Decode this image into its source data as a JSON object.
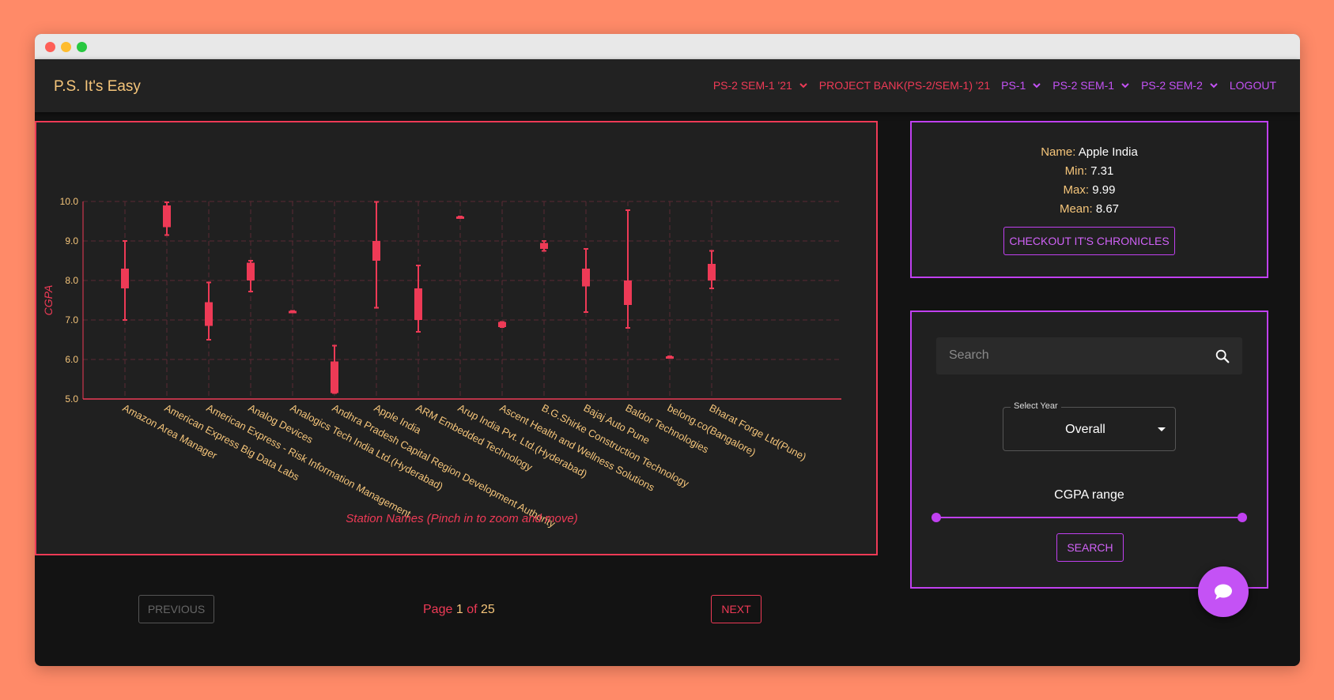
{
  "app": {
    "brand": "P.S. It's Easy"
  },
  "nav": [
    {
      "label": "PS-2 SEM-1 '21",
      "color": "#ee3a56",
      "dropdown": true
    },
    {
      "label": "PROJECT BANK(PS-2/SEM-1) '21",
      "color": "#ee3a56",
      "dropdown": false
    },
    {
      "label": "PS-1",
      "color": "#c452f5",
      "dropdown": true
    },
    {
      "label": "PS-2 SEM-1",
      "color": "#c452f5",
      "dropdown": true
    },
    {
      "label": "PS-2 SEM-2",
      "color": "#c452f5",
      "dropdown": true
    },
    {
      "label": "LOGOUT",
      "color": "#c452f5",
      "dropdown": false
    }
  ],
  "info": {
    "name_key": "Name:",
    "name": "Apple India",
    "min_key": "Min:",
    "min": "7.31",
    "max_key": "Max:",
    "max": "9.99",
    "mean_key": "Mean:",
    "mean": "8.67",
    "chronicles_button": "CHECKOUT IT'S CHRONICLES"
  },
  "filters": {
    "search_placeholder": "Search",
    "select_label": "Select Year",
    "select_value": "Overall",
    "range_label": "CGPA range",
    "range_value": [
      0,
      1
    ],
    "search_button": "SEARCH"
  },
  "pagination": {
    "previous": "PREVIOUS",
    "next": "NEXT",
    "page_word": "Page",
    "current": "1",
    "of_word": "of",
    "total": "25"
  },
  "colors": {
    "accent_red": "#ee3a56",
    "accent_purple": "#c452f5",
    "label_gold": "#f5c57a"
  },
  "chart_data": {
    "type": "box",
    "ylabel": "CGPA",
    "xlabel": "Station Names (Pinch in to zoom and move)",
    "ylim": [
      5.0,
      10.0
    ],
    "yticks": [
      "5.0",
      "6.0",
      "7.0",
      "8.0",
      "9.0",
      "10.0"
    ],
    "grid": true,
    "categories": [
      "Amazon Area Manager",
      "American Express Big Data Labs",
      "American Express - Risk Information Management",
      "Analog Devices",
      "Analogics Tech India Ltd.(Hyderabad)",
      "Andhra Pradesh Capital Region Development Authority",
      "Apple India",
      "ARM Embedded Technology",
      "Arup India Pvt. Ltd.(Hyderabad)",
      "Ascent Health and Wellness Solutions",
      "B.G.Shirke Construction Technology",
      "Bajaj Auto Pune",
      "Baldor Technologies",
      "belong.co(Bangalore)",
      "Bharat Forge Ltd(Pune)"
    ],
    "boxes": [
      {
        "min": 7.0,
        "q1": 7.8,
        "q3": 8.3,
        "max": 9.0
      },
      {
        "min": 9.15,
        "q1": 9.35,
        "q3": 9.9,
        "max": 9.98
      },
      {
        "min": 6.5,
        "q1": 6.85,
        "q3": 7.45,
        "max": 7.95
      },
      {
        "min": 7.72,
        "q1": 8.0,
        "q3": 8.45,
        "max": 8.5
      },
      {
        "min": 7.23,
        "q1": 7.23,
        "q3": 7.23,
        "max": 7.23
      },
      {
        "min": 5.15,
        "q1": 5.15,
        "q3": 5.95,
        "max": 6.35
      },
      {
        "min": 7.31,
        "q1": 8.5,
        "q3": 9.0,
        "max": 9.99
      },
      {
        "min": 6.7,
        "q1": 7.0,
        "q3": 7.8,
        "max": 8.38
      },
      {
        "min": 9.62,
        "q1": 9.62,
        "q3": 9.62,
        "max": 9.62
      },
      {
        "min": 6.82,
        "q1": 6.82,
        "q3": 6.95,
        "max": 6.95
      },
      {
        "min": 8.75,
        "q1": 8.8,
        "q3": 8.95,
        "max": 9.0
      },
      {
        "min": 7.2,
        "q1": 7.85,
        "q3": 8.3,
        "max": 8.8
      },
      {
        "min": 6.8,
        "q1": 7.38,
        "q3": 8.0,
        "max": 9.78
      },
      {
        "min": 6.08,
        "q1": 6.08,
        "q3": 6.08,
        "max": 6.08
      },
      {
        "min": 7.8,
        "q1": 8.0,
        "q3": 8.42,
        "max": 8.75
      }
    ]
  }
}
